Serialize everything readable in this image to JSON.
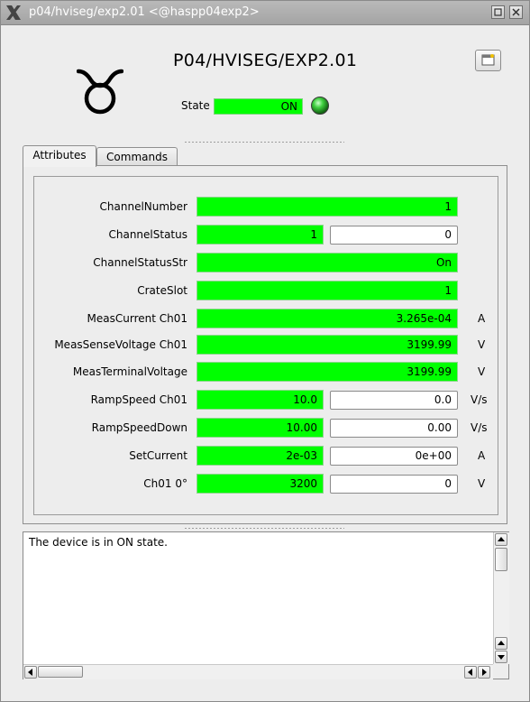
{
  "window": {
    "title": "p04/hviseg/exp2.01 <@haspp04exp2>"
  },
  "header": {
    "device_name": "P04/HVISEG/EXP2.01",
    "state_label": "State",
    "state_value": "ON",
    "state_led_color": "#22aa22"
  },
  "tabs": [
    {
      "label": "Attributes",
      "active": true
    },
    {
      "label": "Commands",
      "active": false
    }
  ],
  "attributes": [
    {
      "label": "ChannelNumber",
      "read": "1",
      "write": null,
      "unit": ""
    },
    {
      "label": "ChannelStatus",
      "read": "1",
      "write": "0",
      "unit": ""
    },
    {
      "label": "ChannelStatusStr",
      "read": "On",
      "write": null,
      "unit": ""
    },
    {
      "label": "CrateSlot",
      "read": "1",
      "write": null,
      "unit": ""
    },
    {
      "label": "MeasCurrent Ch01",
      "read": "3.265e-04",
      "write": null,
      "unit": "A"
    },
    {
      "label": "MeasSenseVoltage Ch01",
      "read": "3199.99",
      "write": null,
      "unit": "V"
    },
    {
      "label": "MeasTerminalVoltage",
      "read": "3199.99",
      "write": null,
      "unit": "V"
    },
    {
      "label": "RampSpeed Ch01",
      "read": "10.0",
      "write": "0.0",
      "unit": "V/s"
    },
    {
      "label": "RampSpeedDown",
      "read": "10.00",
      "write": "0.00",
      "unit": "V/s"
    },
    {
      "label": "SetCurrent",
      "read": "2e-03",
      "write": "0e+00",
      "unit": "A"
    },
    {
      "label": "Ch01 0°",
      "read": "3200",
      "write": "0",
      "unit": "V"
    }
  ],
  "status": {
    "message": "The device is in ON state."
  },
  "colors": {
    "valid": "#00ff00",
    "titlebar": "#a8a8a8"
  }
}
